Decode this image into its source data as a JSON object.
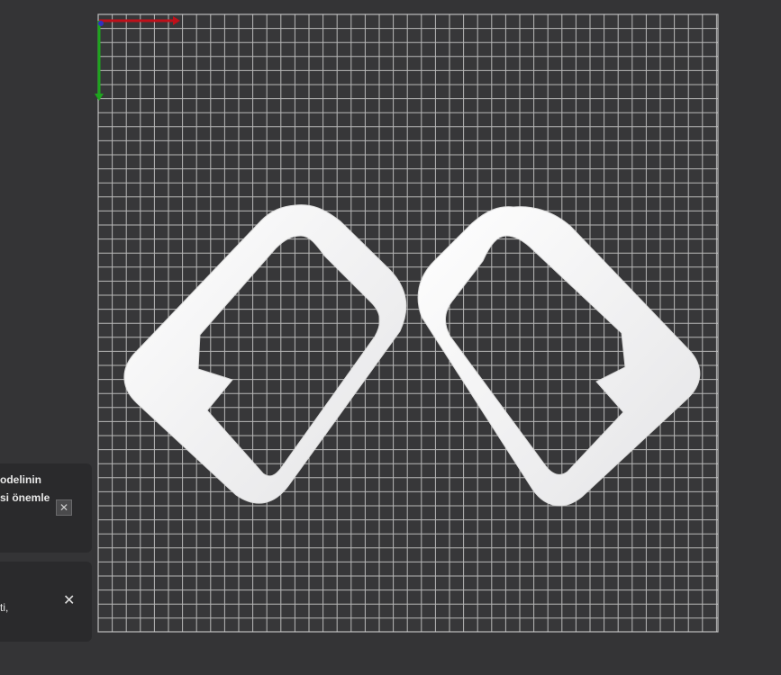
{
  "scene": {
    "bed_color": "#343436",
    "grid_color": "#c8c8c8",
    "model_color": "#f2f2f2",
    "axis_x_color": "#c0101a",
    "axis_y_color": "#1ea51e"
  },
  "notifications": [
    {
      "lines": [
        "odelinin",
        "si önemle"
      ],
      "close_icon": "close-icon"
    },
    {
      "lines": [
        "ti,"
      ],
      "close_icon": "close-icon"
    }
  ]
}
